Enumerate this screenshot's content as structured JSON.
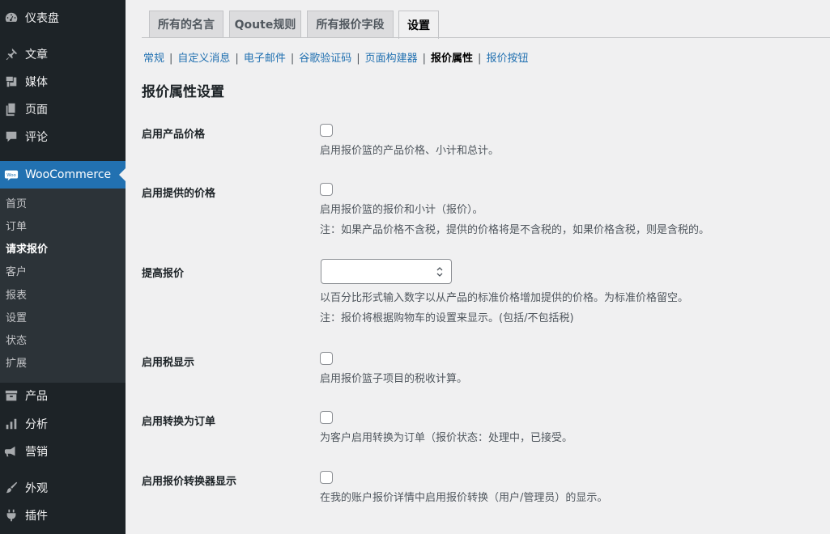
{
  "sidebar": {
    "items": [
      {
        "name": "dashboard",
        "label": "仪表盘",
        "icon": "dashboard-icon"
      },
      {
        "name": "posts",
        "label": "文章",
        "icon": "pin-icon"
      },
      {
        "name": "media",
        "label": "媒体",
        "icon": "media-icon"
      },
      {
        "name": "pages",
        "label": "页面",
        "icon": "pages-icon"
      },
      {
        "name": "comments",
        "label": "评论",
        "icon": "comment-icon"
      },
      {
        "name": "woocommerce",
        "label": "WooCommerce",
        "icon": "woo-icon",
        "active": true
      },
      {
        "name": "products",
        "label": "产品",
        "icon": "archive-icon"
      },
      {
        "name": "analytics",
        "label": "分析",
        "icon": "bar-chart-icon"
      },
      {
        "name": "marketing",
        "label": "营销",
        "icon": "megaphone-icon"
      },
      {
        "name": "appearance",
        "label": "外观",
        "icon": "brush-icon"
      },
      {
        "name": "plugins",
        "label": "插件",
        "icon": "plug-icon"
      }
    ],
    "submenu": [
      "首页",
      "订单",
      "请求报价",
      "客户",
      "报表",
      "设置",
      "状态",
      "扩展"
    ],
    "submenu_current": "请求报价"
  },
  "tabs": [
    "所有的名言",
    "Qoute规则",
    "所有报价字段",
    "设置"
  ],
  "active_tab": "设置",
  "subnav": [
    "常规",
    "自定义消息",
    "电子邮件",
    "谷歌验证码",
    "页面构建器",
    "报价属性",
    "报价按钮"
  ],
  "subnav_current": "报价属性",
  "section_title": "报价属性设置",
  "settings": [
    {
      "label": "启用产品价格",
      "type": "checkbox",
      "checked": false,
      "desc": "启用报价篮的产品价格、小计和总计。"
    },
    {
      "label": "启用提供的价格",
      "type": "checkbox",
      "checked": false,
      "desc": "启用报价篮的报价和小计（报价）。",
      "note": "注：如果产品价格不含税，提供的价格将是不含税的，如果价格含税，则是含税的。"
    },
    {
      "label": "提高报价",
      "type": "number",
      "value": "",
      "desc": "以百分比形式输入数字以从产品的标准价格增加提供的价格。为标准价格留空。",
      "note": "注：报价将根据购物车的设置来显示。(包括/不包括税)"
    },
    {
      "label": "启用税显示",
      "type": "checkbox",
      "checked": false,
      "desc": "启用报价篮子项目的税收计算。"
    },
    {
      "label": "启用转换为订单",
      "type": "checkbox",
      "checked": false,
      "desc": "为客户启用转换为订单（报价状态：处理中，已接受。"
    },
    {
      "label": "启用报价转换器显示",
      "type": "checkbox",
      "checked": false,
      "desc": "在我的账户报价详情中启用报价转换（用户/管理员）的显示。"
    }
  ],
  "colors": {
    "sidebar_bg": "#1d2327",
    "submenu_bg": "#2c3338",
    "accent": "#2271b1",
    "page_bg": "#f0f0f1"
  }
}
